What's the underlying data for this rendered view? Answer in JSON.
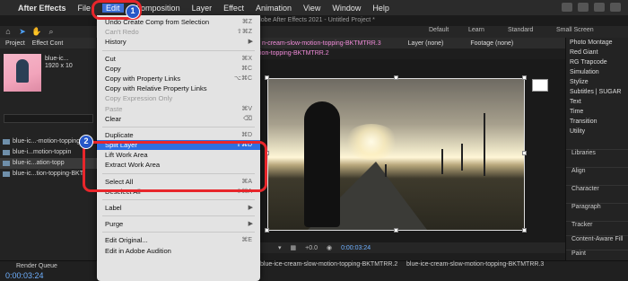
{
  "menubar": {
    "items": [
      "After Effects",
      "File",
      "Edit",
      "Composition",
      "Layer",
      "Effect",
      "Animation",
      "View",
      "Window",
      "Help"
    ],
    "active": "Edit"
  },
  "window_title": "Adobe After Effects 2021 - Untitled Project *",
  "workspaces": [
    "Default",
    "Learn",
    "Standard",
    "Small Screen"
  ],
  "project": {
    "tabs": [
      "Project",
      "Effect Cont"
    ],
    "clip_name": "blue-ic...",
    "clip_size": "1920 x 10",
    "items": [
      "blue-ic...-motion-topping",
      "blue-i...motion-toppin",
      "blue-ic...ation-topp",
      "blue-ic...tion-topping-BKT"
    ]
  },
  "comp": {
    "tabs": [
      "n-cream-slow-motion-topping-BKTMTRR.3",
      "Layer (none)",
      "Footage (none)"
    ],
    "sub_tab": "ion-topping-BKTMTRR.2",
    "timecode": "0:00:03:24",
    "zoom": "+0.0"
  },
  "right_panel": {
    "effects": [
      "Photo Montage",
      "Red Giant",
      "RG Trapcode",
      "Simulation",
      "Stylize",
      "Subtitles | SUGAR",
      "Text",
      "Time",
      "Transition",
      "Utility"
    ],
    "sections": [
      "Libraries",
      "Align",
      "Character",
      "Paragraph",
      "Tracker",
      "Content-Aware Fill",
      "Paint"
    ]
  },
  "timeline": {
    "tabs": [
      "Render Queue"
    ],
    "time": "0:00:03:24",
    "comp_tabs": [
      "blue-ice-cream-slow-motion-topping-BKTMTRR.2",
      "blue-ice-cream-slow-motion-topping-BKTMTRR.3"
    ]
  },
  "edit_menu": {
    "items": [
      {
        "label": "Undo Create Comp from Selection",
        "shortcut": "⌘Z",
        "disabled": false
      },
      {
        "label": "Can't Redo",
        "shortcut": "⇧⌘Z",
        "disabled": true
      },
      {
        "label": "History",
        "submenu": true
      },
      {
        "sep": true
      },
      {
        "label": "Cut",
        "shortcut": "⌘X"
      },
      {
        "label": "Copy",
        "shortcut": "⌘C"
      },
      {
        "label": "Copy with Property Links",
        "shortcut": "⌥⌘C"
      },
      {
        "label": "Copy with Relative Property Links"
      },
      {
        "label": "Copy Expression Only",
        "disabled": true
      },
      {
        "label": "Paste",
        "shortcut": "⌘V",
        "disabled": true
      },
      {
        "label": "Clear",
        "shortcut": "⌫"
      },
      {
        "sep": true
      },
      {
        "label": "Duplicate",
        "shortcut": "⌘D"
      },
      {
        "label": "Split Layer",
        "shortcut": "⇧⌘D",
        "highlighted": true
      },
      {
        "label": "Lift Work Area"
      },
      {
        "label": "Extract Work Area"
      },
      {
        "sep": true
      },
      {
        "label": "Select All",
        "shortcut": "⌘A"
      },
      {
        "label": "Deselect All",
        "shortcut": "⇧⌘A"
      },
      {
        "sep": true
      },
      {
        "label": "Label",
        "submenu": true
      },
      {
        "sep": true
      },
      {
        "label": "Purge",
        "submenu": true
      },
      {
        "sep": true
      },
      {
        "label": "Edit Original...",
        "shortcut": "⌘E"
      },
      {
        "label": "Edit in Adobe Audition"
      }
    ]
  },
  "annotations": {
    "badge1": "1",
    "badge2": "2",
    "ring_color": "#e8262b",
    "badge_color": "#2657c8"
  }
}
